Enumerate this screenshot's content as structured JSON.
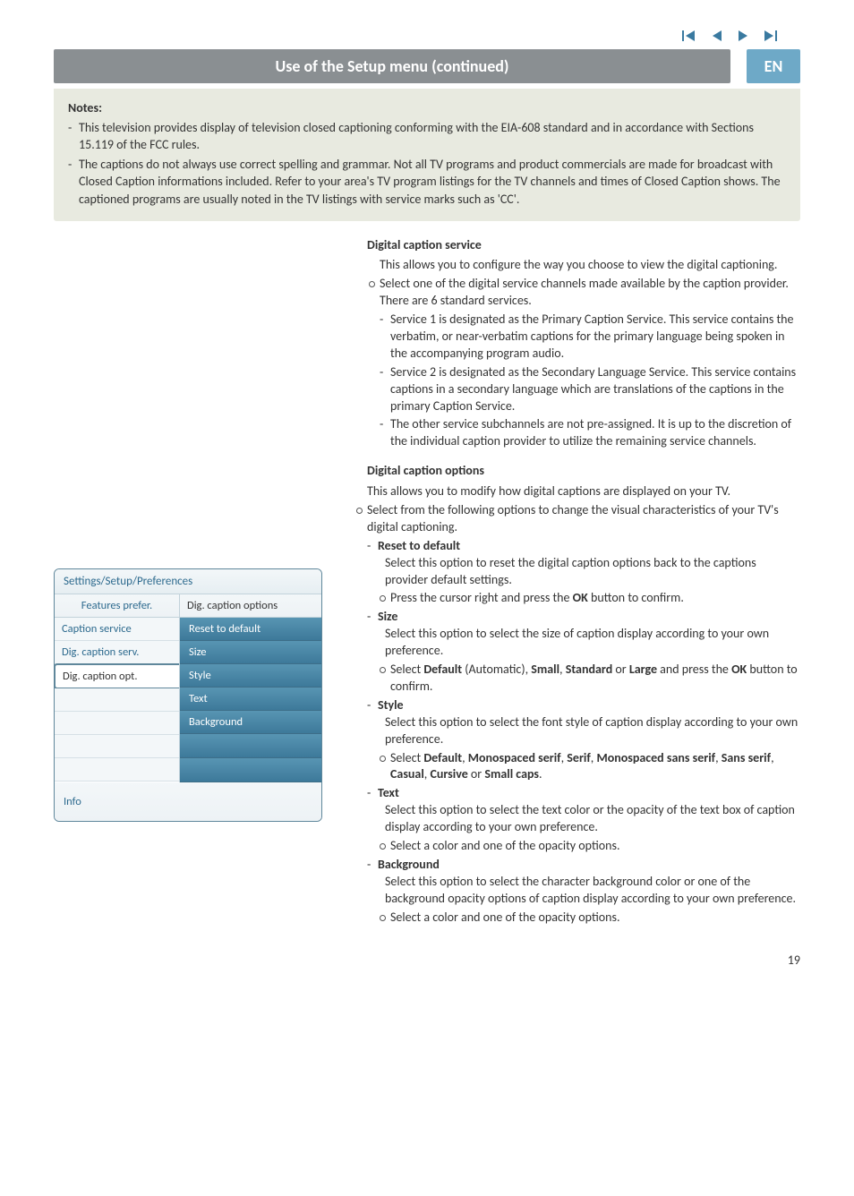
{
  "nav": {
    "icons": [
      "first-icon",
      "prev-icon",
      "next-icon",
      "last-icon"
    ]
  },
  "header": {
    "title": "Use of the Setup menu   (continued)",
    "lang": "EN"
  },
  "notes": {
    "heading": "Notes",
    "items": [
      "This television provides display of television closed captioning conforming with the EIA-608 standard and in accordance with Sections 15.119 of the FCC rules.",
      "The captions do not always use correct spelling and grammar. Not all TV programs and product commercials are made for broadcast with Closed Caption informations included. Refer to your area's TV program listings for the TV channels and times of Closed Caption shows. The captioned programs are usually noted in the TV listings with service marks such as 'CC'."
    ]
  },
  "settings_panel": {
    "breadcrumb": "Settings/Setup/Preferences",
    "left_header": "Features prefer.",
    "right_header": "Dig. caption options",
    "left_items": [
      "Caption service",
      "Dig. caption serv.",
      "Dig. caption opt."
    ],
    "selected_left_index": 2,
    "right_items": [
      "Reset to default",
      "Size",
      "Style",
      "Text",
      "Background"
    ],
    "info": "Info"
  },
  "digital_caption_service": {
    "heading": "Digital caption service",
    "intro": "This allows you to configure the way you choose to view the digital captioning.",
    "select_line": "Select one of the digital service channels made available by the caption provider.",
    "six_line": "There are 6 standard services.",
    "services": [
      "Service 1 is designated as the Primary Caption Service. This service contains the verbatim, or near-verbatim captions for the primary language being spoken in the accompanying program audio.",
      "Service 2 is designated as the Secondary Language Service. This service contains captions in a secondary language which are translations of the captions in the primary Caption Service.",
      "The other service subchannels are not pre-assigned. It is up to the discretion of the individual caption provider to utilize the remaining service channels."
    ]
  },
  "digital_caption_options": {
    "heading": "Digital caption options",
    "intro": "This allows you to modify how digital captions are displayed on your TV.",
    "select_line": "Select from the following options to change the visual characteristics of your TV's digital captioning.",
    "options": {
      "reset": {
        "name": "Reset to default",
        "desc": "Select this option to reset the digital caption options back to the captions provider default settings.",
        "action_prefix": "Press the cursor right and press the ",
        "ok": "OK",
        "action_suffix": " button to confirm."
      },
      "size": {
        "name": "Size",
        "desc": "Select this option to select the size of caption display according to your own preference.",
        "action_prefix": "Select ",
        "default": "Default",
        "auto": " (Automatic), ",
        "small": "Small",
        "comma1": ", ",
        "standard": "Standard",
        "or": " or ",
        "large": "Large",
        "suffix1": " and press the ",
        "ok": "OK",
        "suffix2": " button to confirm."
      },
      "style": {
        "name": "Style",
        "desc": "Select this option to select the font style of caption display according to your own preference.",
        "action_prefix": "Select ",
        "vals": [
          "Default",
          "Monospaced serif",
          "Serif",
          "Monospaced sans serif",
          "Sans serif",
          "Casual",
          "Cursive"
        ],
        "or": " or ",
        "last": "Small caps",
        "period": "."
      },
      "text": {
        "name": "Text",
        "desc": "Select this option to select the text color or the opacity of the text box of caption display according to your own preference.",
        "action": "Select a color and one of the opacity options."
      },
      "background": {
        "name": "Background",
        "desc": "Select this option to select the character background color or one of the background opacity options of caption display according to your own preference.",
        "action": "Select a color and one of the opacity options."
      }
    }
  },
  "page_number": "19"
}
